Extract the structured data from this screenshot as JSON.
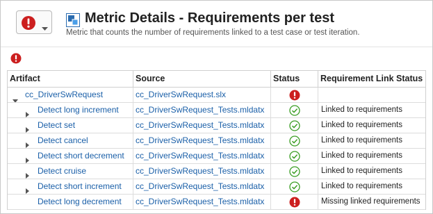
{
  "header": {
    "title": "Metric Details - Requirements per test",
    "subtitle": "Metric that counts the number of requirements linked to a test case or test iteration."
  },
  "colors": {
    "error": "#cc1f1f",
    "pass": "#3a9d23",
    "link": "#1a5fa8"
  },
  "table": {
    "columns": [
      "Artifact",
      "Source",
      "Status",
      "Requirement Link Status"
    ],
    "rows": [
      {
        "artifact": "cc_DriverSwRequest",
        "source": "cc_DriverSwRequest.slx",
        "status": "error",
        "link_status": "",
        "level": 0,
        "caret": "expanded"
      },
      {
        "artifact": "Detect long increment",
        "source": "cc_DriverSwRequest_Tests.mldatx",
        "status": "pass",
        "link_status": "Linked to requirements",
        "level": 1,
        "caret": "collapsed"
      },
      {
        "artifact": "Detect set",
        "source": "cc_DriverSwRequest_Tests.mldatx",
        "status": "pass",
        "link_status": "Linked to requirements",
        "level": 1,
        "caret": "collapsed"
      },
      {
        "artifact": "Detect cancel",
        "source": "cc_DriverSwRequest_Tests.mldatx",
        "status": "pass",
        "link_status": "Linked to requirements",
        "level": 1,
        "caret": "collapsed"
      },
      {
        "artifact": "Detect short decrement",
        "source": "cc_DriverSwRequest_Tests.mldatx",
        "status": "pass",
        "link_status": "Linked to requirements",
        "level": 1,
        "caret": "collapsed"
      },
      {
        "artifact": "Detect cruise",
        "source": "cc_DriverSwRequest_Tests.mldatx",
        "status": "pass",
        "link_status": "Linked to requirements",
        "level": 1,
        "caret": "collapsed"
      },
      {
        "artifact": "Detect short increment",
        "source": "cc_DriverSwRequest_Tests.mldatx",
        "status": "pass",
        "link_status": "Linked to requirements",
        "level": 1,
        "caret": "collapsed"
      },
      {
        "artifact": "Detect long decrement",
        "source": "cc_DriverSwRequest_Tests.mldatx",
        "status": "error",
        "link_status": "Missing linked requirements",
        "level": 1,
        "caret": "none"
      }
    ]
  }
}
